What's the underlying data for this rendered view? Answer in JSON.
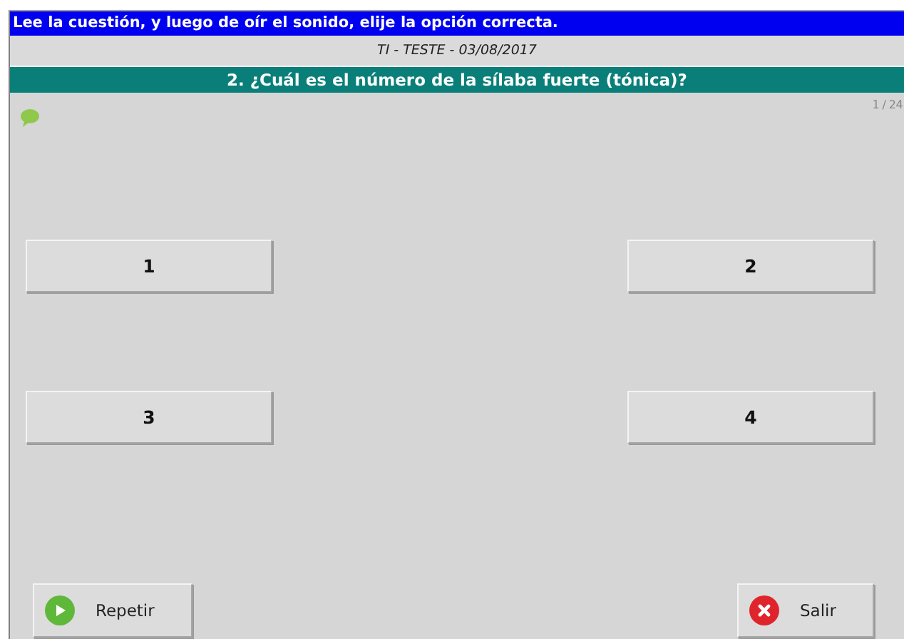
{
  "instruction": "Lee la cuestión, y luego de oír el sonido, elije la opción correcta.",
  "test_title": "TI - TESTE - 03/08/2017",
  "question": "2. ¿Cuál es el número de la sílaba fuerte (tónica)?",
  "counter": "1 / 24",
  "options": [
    "1",
    "2",
    "3",
    "4"
  ],
  "buttons": [
    {
      "kind": "repeat",
      "label": "Repetir"
    },
    {
      "kind": "exit",
      "label": "Salir"
    }
  ]
}
